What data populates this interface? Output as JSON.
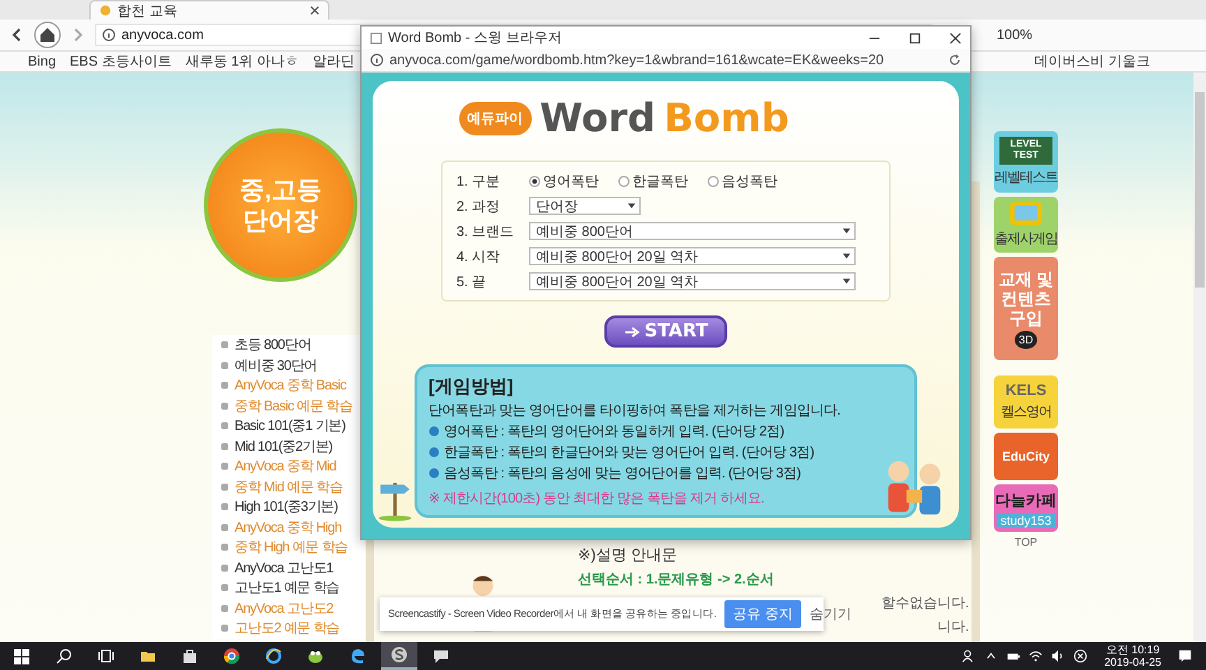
{
  "browser": {
    "tab_title": "합천 교육",
    "url": "anyvoca.com",
    "zoom": "100%",
    "bookmarks": [
      "Bing",
      "EBS 초등사이트",
      "새루동 1위 아나ㅎ",
      "알라딘"
    ],
    "bookmark_right": "데이버스비 기울크"
  },
  "site": {
    "logo_lines": [
      "중,고등",
      "단어장"
    ],
    "menu": [
      {
        "label": "초등 800단어",
        "color": "#333333"
      },
      {
        "label": "예비중 30단어",
        "color": "#333333"
      },
      {
        "label": "AnyVoca 중학 Basic",
        "color": "#e08a2c"
      },
      {
        "label": "중학 Basic 예문 학습",
        "color": "#e08a2c"
      },
      {
        "label": "Basic 101(중1 기본)",
        "color": "#333333"
      },
      {
        "label": "Mid 101(중2기본)",
        "color": "#333333"
      },
      {
        "label": "AnyVoca 중학 Mid",
        "color": "#e08a2c"
      },
      {
        "label": "중학 Mid 예문 학습",
        "color": "#e08a2c"
      },
      {
        "label": "High 101(중3기본)",
        "color": "#333333"
      },
      {
        "label": "AnyVoca 중학 High",
        "color": "#e08a2c"
      },
      {
        "label": "중학 High 예문 학습",
        "color": "#e08a2c"
      },
      {
        "label": "AnyVoca 고난도1",
        "color": "#333333"
      },
      {
        "label": "고난도1 예문 학습",
        "color": "#333333"
      },
      {
        "label": "AnyVoca 고난도2",
        "color": "#e08a2c"
      },
      {
        "label": "고난도2 예문 학습",
        "color": "#e08a2c"
      }
    ],
    "notice_title": "※)설명 안내문",
    "notice_order": "선택순서 : 1.문제유형 -> 2.순서",
    "notice_fragments": [
      "할수없습니다.",
      "니다."
    ],
    "side_banners": [
      {
        "kind": "level",
        "title": "LEVEL TEST",
        "caption": "레벨테스트"
      },
      {
        "kind": "game",
        "caption": "출제사게임"
      },
      {
        "kind": "shop",
        "title": "교재 및 컨텐츠 구입",
        "badge": "3D"
      },
      {
        "kind": "kels",
        "title": "KELS",
        "caption": "켈스영어"
      },
      {
        "kind": "city",
        "caption": "EduCity"
      },
      {
        "kind": "cafe",
        "title": "다늘카페",
        "caption": "study153"
      }
    ],
    "top_link": "TOP"
  },
  "popup": {
    "title": "Word Bomb - 스윙 브라우저",
    "url": "anyvoca.com/game/wordbomb.htm?key=1&wbrand=161&wcate=EK&weeks=20",
    "badge": "예듀파이",
    "title_word": "Word",
    "title_bomb": "Bomb",
    "form": [
      {
        "label": "1. 구분",
        "kind": "radio",
        "options": [
          {
            "label": "영어폭탄",
            "selected": true
          },
          {
            "label": "한글폭탄",
            "selected": false
          },
          {
            "label": "음성폭탄",
            "selected": false
          }
        ]
      },
      {
        "label": "2. 과정",
        "kind": "select",
        "value": "단어장",
        "wide": false
      },
      {
        "label": "3. 브랜드",
        "kind": "select",
        "value": "예비중 800단어",
        "wide": true
      },
      {
        "label": "4. 시작",
        "kind": "select",
        "value": "예비중 800단어 20일 역차",
        "wide": true
      },
      {
        "label": "5. 끝",
        "kind": "select",
        "value": "예비중 800단어 20일 역차",
        "wide": true
      }
    ],
    "start": "START",
    "howto": {
      "heading": "[게임방법]",
      "intro": "단어폭탄과 맞는 영어단어를 타이핑하여 폭탄을 제거하는 게임입니다.",
      "rules": [
        "영어폭탄 : 폭탄의 영어단어와 동일하게 입력. (단어당 2점)",
        "한글폭탄 : 폭탄의 한글단어와 맞는 영어단어 입력. (단어당 3점)",
        "음성폭탄 : 폭탄의 음성에 맞는 영어단어를 입력. (단어당 3점)"
      ],
      "note": "※ 제한시간(100초) 동안 최대한 많은 폭탄을 제거 하세요."
    }
  },
  "notification": {
    "text": "Screencastify - Screen Video Recorder에서 내 화면을 공유하는 중입니다.",
    "primary": "공유 중지",
    "secondary": "숨기기"
  },
  "taskbar": {
    "apps": [
      {
        "kind": "search",
        "selected": false
      },
      {
        "kind": "taskview",
        "selected": false
      },
      {
        "kind": "folder",
        "selected": false
      },
      {
        "kind": "store",
        "selected": false
      },
      {
        "kind": "chrome",
        "selected": false
      },
      {
        "kind": "ie",
        "selected": false
      },
      {
        "kind": "frog",
        "selected": false
      },
      {
        "kind": "edge",
        "selected": false
      },
      {
        "kind": "screencastify",
        "selected": true
      },
      {
        "kind": "chat",
        "selected": false
      }
    ],
    "time": "오전 10:19",
    "date": "2019-04-25"
  }
}
